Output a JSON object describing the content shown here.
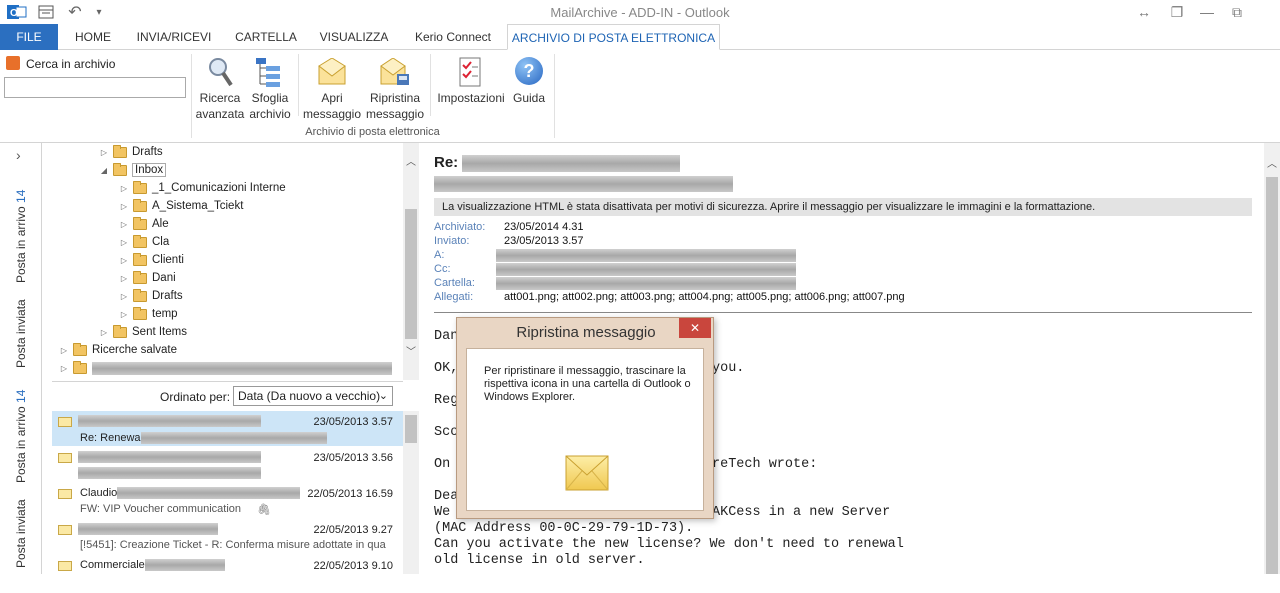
{
  "window": {
    "title": "MailArchive - ADD-IN - Outlook",
    "undo": "↶",
    "qat_more": "▾",
    "min": "—",
    "restore": "❐",
    "max": "⧉",
    "resize": "↔"
  },
  "tabs": [
    "FILE",
    "HOME",
    "INVIA/RICEVI",
    "CARTELLA",
    "VISUALIZZA",
    "Kerio Connect",
    "ARCHIVIO DI POSTA ELETTRONICA"
  ],
  "ribbon": {
    "search_label": "Cerca in archivio",
    "search_value": "",
    "buttons": [
      {
        "line1": "Ricerca",
        "line2": "avanzata"
      },
      {
        "line1": "Sfoglia",
        "line2": "archivio"
      },
      {
        "line1": "Apri",
        "line2": "messaggio"
      },
      {
        "line1": "Ripristina",
        "line2": "messaggio"
      },
      {
        "line1": "Impostazioni",
        "line2": ""
      },
      {
        "line1": "Guida",
        "line2": ""
      }
    ],
    "group_label": "Archivio di posta elettronica",
    "help_glyph": "?"
  },
  "left_tabs": [
    {
      "label": "Posta in arrivo",
      "count": "14"
    },
    {
      "label": "Posta inviata",
      "count": ""
    },
    {
      "label": "Posta in arrivo",
      "count": "14"
    },
    {
      "label": "Posta inviata",
      "count": ""
    }
  ],
  "left_expand": "›",
  "folders": [
    {
      "label": "Drafts",
      "arrow": "▷"
    },
    {
      "label": "Inbox",
      "arrow": "◢"
    },
    {
      "label": "_1_Comunicazioni Interne",
      "arrow": "▷"
    },
    {
      "label": "A_Sistema_Tciekt",
      "arrow": "▷"
    },
    {
      "label": "Ale",
      "arrow": "▷"
    },
    {
      "label": "Cla",
      "arrow": "▷"
    },
    {
      "label": "Clienti",
      "arrow": "▷"
    },
    {
      "label": "Dani",
      "arrow": "▷"
    },
    {
      "label": "Drafts",
      "arrow": "▷"
    },
    {
      "label": "temp",
      "arrow": "▷"
    },
    {
      "label": "Sent Items",
      "arrow": "▷"
    },
    {
      "label": "Ricerche salvate",
      "arrow": "▷"
    },
    {
      "label": "",
      "arrow": "▷"
    }
  ],
  "sort": {
    "label": "Ordinato per:",
    "value": "Data (Da nuovo a vecchio)"
  },
  "messages": [
    {
      "from": "",
      "date": "23/05/2013 3.57",
      "subject": "Re: Renewa"
    },
    {
      "from": "",
      "date": "23/05/2013 3.56",
      "subject": ""
    },
    {
      "from": "Claudio",
      "date": "22/05/2013 16.59",
      "subject": "FW: VIP Voucher communication"
    },
    {
      "from": "",
      "date": "22/05/2013 9.27",
      "subject": "[!5451]: Creazione Ticket - R: Conferma misure adottate in qua"
    },
    {
      "from": "Commerciale",
      "date": "22/05/2013 9.10",
      "subject": ""
    }
  ],
  "reading": {
    "subject_prefix": "Re:",
    "notice": "La visualizzazione HTML è stata disattivata per motivi di sicurezza. Aprire il messaggio per visualizzare le immagini e la formattazione.",
    "fields": [
      {
        "label": "Archiviato:",
        "value": "23/05/2014 4.31"
      },
      {
        "label": "Inviato:",
        "value": "23/05/2013 3.57"
      },
      {
        "label": "A:",
        "value": ""
      },
      {
        "label": "Cc:",
        "value": ""
      },
      {
        "label": "Cartella:",
        "value": ""
      },
      {
        "label": "Allegati:",
        "value": "att001.png; att002.png; att003.png; att004.png; att005.png; att006.png; att007.png"
      }
    ],
    "body": [
      {
        "text": "Dan"
      },
      {
        "text": "OK,"
      },
      {
        "text": "you."
      },
      {
        "text": "Reg"
      },
      {
        "text": "Sco"
      },
      {
        "text": "On "
      },
      {
        "text": "reTech wrote:"
      },
      {
        "text": "Dea"
      },
      {
        "text": "We "
      },
      {
        "text": "AKCess in a new Server"
      },
      {
        "text": "(MAC Address 00-0C-29-79-1D-73)."
      },
      {
        "text": "Can you activate the new license? We don't need to renewal"
      },
      {
        "text": "old license in old server."
      }
    ]
  },
  "dialog": {
    "title": "Ripristina messaggio",
    "close": "✕",
    "text": "Per ripristinare il messaggio, trascinare la rispettiva icona in una cartella di Outlook o Windows Explorer."
  }
}
